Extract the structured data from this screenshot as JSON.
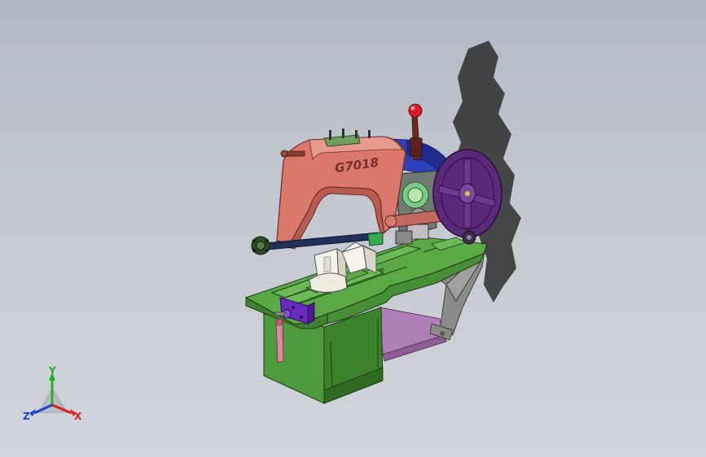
{
  "viewport": {
    "background_top": "#b3b9c4",
    "background_bottom": "#d2d5db"
  },
  "model": {
    "frame_label": "G7018",
    "colors": {
      "saw_frame": "#d9786b",
      "base_green": "#4e9a3c",
      "table_green": "#5aa846",
      "motor_blue": "#2f3fb8",
      "flywheel_purple": "#5a2a78",
      "handle_ball_red": "#d81a2a",
      "vise_purple": "#6a2ac0",
      "pink_support": "#b07fb8",
      "shadow": "#2a2a2a"
    }
  },
  "triad": {
    "x_label": "X",
    "y_label": "Y",
    "z_label": "Z",
    "x_color": "#d92020",
    "y_color": "#20b020",
    "z_color": "#2040d0"
  }
}
